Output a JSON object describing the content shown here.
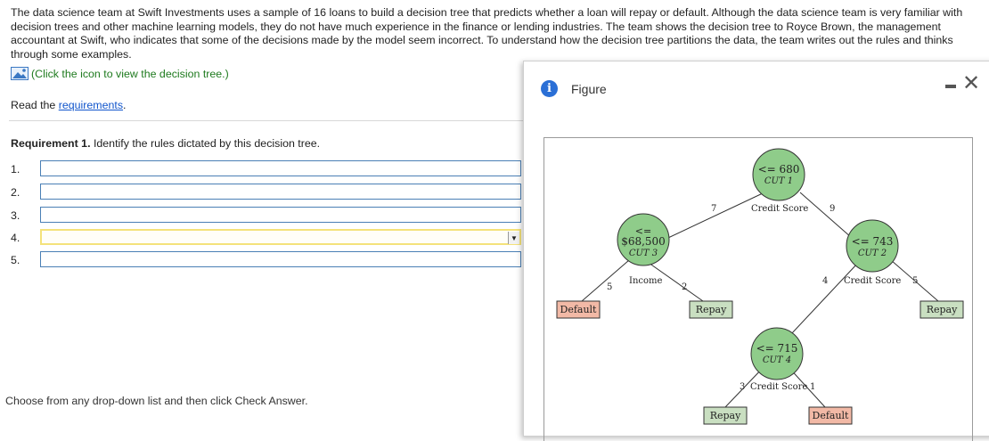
{
  "intro": {
    "text": "The data science team at Swift Investments uses a sample of 16 loans to build a decision tree that predicts whether a loan will repay or default. Although the data science team is very familiar with decision trees and other machine learning models, they do not have much experience in the finance or lending industries. The team shows the decision tree to Royce Brown, the management accountant at Swift, who indicates that some of the decisions made by the model seem incorrect. To understand how the decision tree partitions the data, the team writes out the rules and thinks through some examples."
  },
  "click_icon_text": "(Click the icon to view the decision tree.)",
  "read_prefix": "Read the ",
  "requirements_link": "requirements",
  "read_suffix": ".",
  "requirement": {
    "label": "Requirement 1.",
    "text": " Identify the rules dictated by this decision tree."
  },
  "rows": [
    {
      "num": "1."
    },
    {
      "num": "2."
    },
    {
      "num": "3."
    },
    {
      "num": "4."
    },
    {
      "num": "5."
    }
  ],
  "dropdown_arrow": "▼",
  "choose_text": "Choose from any drop-down list and then click Check Answer.",
  "figure": {
    "title": "Figure",
    "info_glyph": "i",
    "close_glyph": "✕"
  },
  "tree": {
    "nodes": {
      "n1": {
        "top": "<= 680",
        "cut": "CUT 1"
      },
      "n2": {
        "top": "<=",
        "mid": "$68,500",
        "cut": "CUT 3"
      },
      "n3": {
        "top": "<= 743",
        "cut": "CUT 2"
      },
      "n4": {
        "top": "<= 715",
        "cut": "CUT 4"
      }
    },
    "branch_labels": {
      "b1": "Credit Score",
      "b1_left": "7",
      "b1_right": "9",
      "b2": "Income",
      "b2_left": "5",
      "b2_right": "2",
      "b3": "Credit Score",
      "b3_left": "4",
      "b3_right": "5",
      "b4": "Credit Score",
      "b4_left": "3",
      "b4_right": "1"
    },
    "leaves": {
      "l1": "Default",
      "l2": "Repay",
      "l3": "Repay",
      "l4": "Repay",
      "l5": "Default"
    },
    "colors": {
      "node_fill": "#8fcc8a",
      "repay_fill": "#c9dfc1",
      "default_fill": "#f2b9a6"
    }
  }
}
